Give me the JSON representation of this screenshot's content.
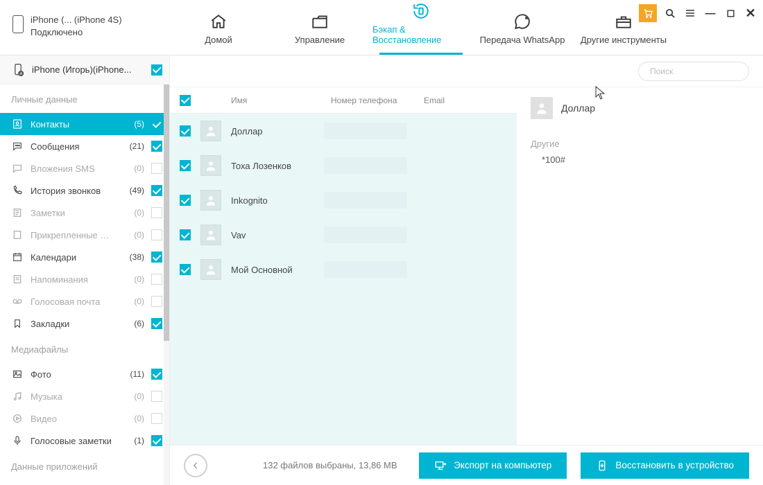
{
  "device": {
    "name": "iPhone (... (iPhone 4S)",
    "status": "Подключено"
  },
  "topnav": {
    "home": "Домой",
    "manage": "Управление",
    "backup": "Бэкап & Восстановление",
    "whatsapp": "Передача WhatsApp",
    "tools": "Другие инструменты"
  },
  "sidebar": {
    "device_label": "iPhone (Игорь)(iPhone...",
    "sections": {
      "personal": "Личные данные",
      "media": "Медиафайлы",
      "apps": "Данные приложений"
    },
    "items": {
      "contacts": {
        "label": "Контакты",
        "count": "(5)"
      },
      "messages": {
        "label": "Сообщения",
        "count": "(21)"
      },
      "sms_att": {
        "label": "Вложения SMS",
        "count": "(0)"
      },
      "calls": {
        "label": "История звонков",
        "count": "(49)"
      },
      "notes": {
        "label": "Заметки",
        "count": "(0)"
      },
      "note_att": {
        "label": "Прикрепленные фа...",
        "count": "(0)"
      },
      "calendar": {
        "label": "Календари",
        "count": "(38)"
      },
      "reminders": {
        "label": "Напоминания",
        "count": "(0)"
      },
      "voicemail": {
        "label": "Голосовая почта",
        "count": "(0)"
      },
      "bookmarks": {
        "label": "Закладки",
        "count": "(6)"
      },
      "photos": {
        "label": "Фото",
        "count": "(11)"
      },
      "music": {
        "label": "Музыка",
        "count": "(0)"
      },
      "video": {
        "label": "Видео",
        "count": "(0)"
      },
      "memos": {
        "label": "Голосовые заметки",
        "count": "(1)"
      }
    }
  },
  "search": {
    "placeholder": "Поиск"
  },
  "table": {
    "head": {
      "name": "Имя",
      "phone": "Номер телефона",
      "email": "Email"
    },
    "rows": [
      {
        "name": "Доллар"
      },
      {
        "name": "Тоха  Лозенков"
      },
      {
        "name": "Inkognito"
      },
      {
        "name": "Vav"
      },
      {
        "name": "Мой  Основной"
      }
    ]
  },
  "detail": {
    "name": "Доллар",
    "other_label": "Другие",
    "other_value": "*100#"
  },
  "footer": {
    "status": "132 файлов выбраны, 13,86 MB",
    "export": "Экспорт на компьютер",
    "restore": "Восстановить в устройство"
  }
}
